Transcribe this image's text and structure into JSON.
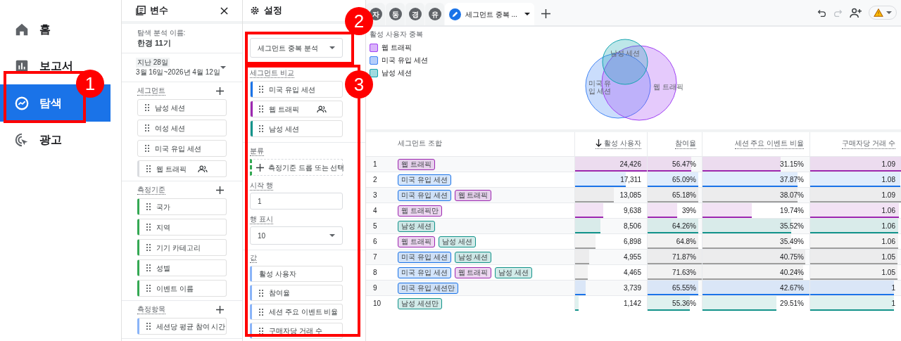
{
  "nav": [
    {
      "label": "홈",
      "selected": false
    },
    {
      "label": "보고서",
      "selected": false
    },
    {
      "label": "탐색",
      "selected": true
    },
    {
      "label": "광고",
      "selected": false
    }
  ],
  "variables": {
    "title": "변수",
    "name_label": "탐색 분석 이름:",
    "name": "한경 11기",
    "date_preset": "지난 28일",
    "date_range": "3월 16일~2026년 4월 12일",
    "sections": [
      {
        "title": "세그먼트",
        "kind": "segment",
        "items": [
          {
            "label": "남성 세션",
            "shared": false
          },
          {
            "label": "여성 세션",
            "shared": false
          },
          {
            "label": "미국 유입 세션",
            "shared": false
          },
          {
            "label": "웹 트래픽",
            "shared": true
          }
        ]
      },
      {
        "title": "측정기준",
        "kind": "dimension",
        "items": [
          {
            "label": "국가"
          },
          {
            "label": "지역"
          },
          {
            "label": "기기 카테고리"
          },
          {
            "label": "성별"
          },
          {
            "label": "이벤트 이름"
          }
        ]
      },
      {
        "title": "측정항목",
        "kind": "metric",
        "items": [
          {
            "label": "세션당 평균 참여 시간"
          }
        ]
      }
    ]
  },
  "settings": {
    "title": "설정",
    "technique": "세그먼트 중복 분석",
    "compare_label": "세그먼트 비교",
    "compare": [
      {
        "label": "미국 유입 세션",
        "color": "#1a73e8",
        "shared": false
      },
      {
        "label": "웹 트래픽",
        "color": "#9c27b0",
        "shared": true
      },
      {
        "label": "남성 세션",
        "color": "#12938a",
        "shared": false
      }
    ],
    "breakdown_label": "분류",
    "breakdown_placeholder": "측정기준 드롭 또는 선택",
    "start_row_label": "시작 행",
    "start_row": "1",
    "rows_label": "행 표시",
    "rows": "10",
    "values_label": "값",
    "values": [
      {
        "label": "활성 사용자",
        "draggable": false
      },
      {
        "label": "참여율",
        "draggable": true
      },
      {
        "label": "세션 주요 이벤트 비율",
        "draggable": true
      },
      {
        "label": "구매자당 거래 수",
        "draggable": true
      }
    ]
  },
  "tabs": [
    {
      "label": "자",
      "kind": "avatar",
      "selected": false
    },
    {
      "label": "동",
      "kind": "avatar",
      "selected": false
    },
    {
      "label": "경",
      "kind": "avatar",
      "selected": false
    },
    {
      "label": "유",
      "kind": "avatar",
      "selected": false
    },
    {
      "label": "세그먼트 중복 ...",
      "kind": "edit",
      "selected": true
    }
  ],
  "chart": {
    "title": "활성 사용자 중복",
    "legend": [
      {
        "label": "웹 트래픽",
        "color": "#a142f4"
      },
      {
        "label": "미국 유입 세션",
        "color": "#4285f4"
      },
      {
        "label": "남성 세션",
        "color": "#12a4af"
      }
    ],
    "venn_labels": [
      "남성 세션",
      "미국 유입 세션",
      "웹 트래픽"
    ]
  },
  "table": {
    "columns": [
      {
        "label": "세그먼트 조합",
        "sorted": false
      },
      {
        "label": "활성 사용자",
        "sorted": true
      },
      {
        "label": "참여율",
        "sorted": false
      },
      {
        "label": "세션 주요 이벤트 비율",
        "sorted": false
      },
      {
        "label": "구매자당 거래 수",
        "sorted": false
      }
    ],
    "rows": [
      {
        "number": "1",
        "color": "#9c27b0",
        "cells": [
          {
            "kind": "segments",
            "tags": [
              {
                "label": "웹 트래픽",
                "color": "#9c27b0"
              }
            ]
          },
          {
            "kind": "metric",
            "text": "24,426",
            "level": 1
          },
          {
            "kind": "metric",
            "text": "56.47%",
            "level": 0.81
          },
          {
            "kind": "metric",
            "text": "31.15%",
            "level": 0.73
          },
          {
            "kind": "metric",
            "text": "1.09",
            "level": 1
          }
        ]
      },
      {
        "number": "2",
        "color": "#1a73e8",
        "cells": [
          {
            "kind": "segments",
            "tags": [
              {
                "label": "미국 유입 세션",
                "color": "#1a73e8"
              }
            ]
          },
          {
            "kind": "metric",
            "text": "17,311",
            "level": 0.71
          },
          {
            "kind": "metric",
            "text": "65.09%",
            "level": 0.94
          },
          {
            "kind": "metric",
            "text": "37.87%",
            "level": 0.89
          },
          {
            "kind": "metric",
            "text": "1.08",
            "level": 0.99
          }
        ]
      },
      {
        "number": "3",
        "color": "#9e9e9e",
        "cells": [
          {
            "kind": "segments",
            "tags": [
              {
                "label": "미국 유입 세션",
                "color": "#1a73e8"
              },
              {
                "label": "웹 트래픽",
                "color": "#9c27b0"
              }
            ]
          },
          {
            "kind": "metric",
            "text": "13,085",
            "level": 0.54
          },
          {
            "kind": "metric",
            "text": "65.18%",
            "level": 0.94
          },
          {
            "kind": "metric",
            "text": "38.07%",
            "level": 0.89
          },
          {
            "kind": "metric",
            "text": "1.09",
            "level": 1
          }
        ]
      },
      {
        "number": "4",
        "color": "#9c27b0",
        "cells": [
          {
            "kind": "segments",
            "tags": [
              {
                "label": "웹 트래픽만",
                "color": "#9c27b0"
              }
            ]
          },
          {
            "kind": "metric",
            "text": "9,638",
            "level": 0.39
          },
          {
            "kind": "metric",
            "text": "39%",
            "level": 0.54
          },
          {
            "kind": "metric",
            "text": "19.74%",
            "level": 0.46
          },
          {
            "kind": "metric",
            "text": "1.06",
            "level": 0.98
          }
        ]
      },
      {
        "number": "5",
        "color": "#12938a",
        "cells": [
          {
            "kind": "segments",
            "tags": [
              {
                "label": "남성 세션",
                "color": "#12938a"
              }
            ]
          },
          {
            "kind": "metric",
            "text": "8,506",
            "level": 0.35
          },
          {
            "kind": "metric",
            "text": "64.26%",
            "level": 0.93
          },
          {
            "kind": "metric",
            "text": "35.52%",
            "level": 0.83
          },
          {
            "kind": "metric",
            "text": "1.06",
            "level": 0.97
          }
        ]
      },
      {
        "number": "6",
        "color": "#9e9e9e",
        "cells": [
          {
            "kind": "segments",
            "tags": [
              {
                "label": "웹 트래픽",
                "color": "#9c27b0"
              },
              {
                "label": "남성 세션",
                "color": "#12938a"
              }
            ]
          },
          {
            "kind": "metric",
            "text": "6,898",
            "level": 0.28
          },
          {
            "kind": "metric",
            "text": "64.8%",
            "level": 0.94
          },
          {
            "kind": "metric",
            "text": "35.49%",
            "level": 0.83
          },
          {
            "kind": "metric",
            "text": "1.06",
            "level": 0.97
          }
        ]
      },
      {
        "number": "7",
        "color": "#9e9e9e",
        "cells": [
          {
            "kind": "segments",
            "tags": [
              {
                "label": "미국 유입 세션",
                "color": "#1a73e8"
              },
              {
                "label": "남성 세션",
                "color": "#12938a"
              }
            ]
          },
          {
            "kind": "metric",
            "text": "4,955",
            "level": 0.2
          },
          {
            "kind": "metric",
            "text": "71.87%",
            "level": 1
          },
          {
            "kind": "metric",
            "text": "40.75%",
            "level": 0.96
          },
          {
            "kind": "metric",
            "text": "1.05",
            "level": 0.96
          }
        ]
      },
      {
        "number": "8",
        "color": "#9e9e9e",
        "cells": [
          {
            "kind": "segments",
            "tags": [
              {
                "label": "미국 유입 세션",
                "color": "#1a73e8"
              },
              {
                "label": "웹 트래픽",
                "color": "#9c27b0"
              },
              {
                "label": "남성 세션",
                "color": "#12938a"
              }
            ]
          },
          {
            "kind": "metric",
            "text": "4,465",
            "level": 0.18
          },
          {
            "kind": "metric",
            "text": "71.63%",
            "level": 1
          },
          {
            "kind": "metric",
            "text": "40.24%",
            "level": 0.94
          },
          {
            "kind": "metric",
            "text": "1.05",
            "level": 0.96
          }
        ]
      },
      {
        "number": "9",
        "color": "#1a73e8",
        "cells": [
          {
            "kind": "segments",
            "tags": [
              {
                "label": "미국 유입 세션만",
                "color": "#1a73e8"
              }
            ]
          },
          {
            "kind": "metric",
            "text": "3,739",
            "level": 0.15
          },
          {
            "kind": "metric",
            "text": "65.55%",
            "level": 0.94
          },
          {
            "kind": "metric",
            "text": "42.67%",
            "level": 1
          },
          {
            "kind": "metric",
            "text": "1",
            "level": 0.92
          }
        ]
      },
      {
        "number": "10",
        "color": "#12938a",
        "cells": [
          {
            "kind": "segments",
            "tags": [
              {
                "label": "남성 세션만",
                "color": "#12938a"
              }
            ]
          },
          {
            "kind": "metric",
            "text": "1,142",
            "level": 0.05
          },
          {
            "kind": "metric",
            "text": "55.36%",
            "level": 0.78
          },
          {
            "kind": "metric",
            "text": "29.51%",
            "level": 0.69
          },
          {
            "kind": "metric",
            "text": "1",
            "level": 0.92
          }
        ]
      }
    ]
  },
  "callouts": [
    {
      "number": "1"
    },
    {
      "number": "2"
    },
    {
      "number": "3"
    }
  ]
}
